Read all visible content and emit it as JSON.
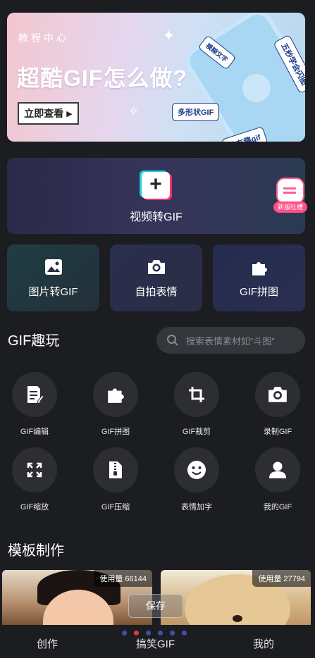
{
  "banner": {
    "subtitle": "教程中心",
    "title": "超酷GIF怎么做?",
    "cta": "立即查看",
    "tags": [
      "模糊文字",
      "五秒学会闪图",
      "多形状GIF",
      "做有趣gif"
    ]
  },
  "video_card": {
    "label": "视频转GIF",
    "badge": "新版吐槽"
  },
  "features": [
    {
      "label": "图片转GIF",
      "icon": "image-icon"
    },
    {
      "label": "自拍表情",
      "icon": "camera-icon"
    },
    {
      "label": "GIF拼图",
      "icon": "puzzle-icon"
    }
  ],
  "gif_fun": {
    "title": "GIF趣玩",
    "search_placeholder": "搜索表情素材如“斗图”",
    "tools": [
      {
        "label": "GIF编辑",
        "icon": "edit-doc-icon"
      },
      {
        "label": "GIF拼图",
        "icon": "puzzle-icon"
      },
      {
        "label": "GIF裁剪",
        "icon": "crop-icon"
      },
      {
        "label": "录制GIF",
        "icon": "camera-icon"
      },
      {
        "label": "GIF缩放",
        "icon": "resize-icon"
      },
      {
        "label": "GIF压缩",
        "icon": "zip-file-icon"
      },
      {
        "label": "表情加字",
        "icon": "smiley-icon"
      },
      {
        "label": "我的GIF",
        "icon": "person-icon"
      }
    ]
  },
  "templates": {
    "title": "模板制作",
    "items": [
      {
        "usage": "使用量 66144"
      },
      {
        "usage": "使用量 27794"
      }
    ],
    "save": "保存"
  },
  "nav": {
    "items": [
      "创作",
      "搞笑GIF",
      "我的"
    ]
  },
  "colors": {
    "accent": "#ff4f86",
    "dot_active": "#e53935",
    "dot": "#3f4fb0"
  }
}
